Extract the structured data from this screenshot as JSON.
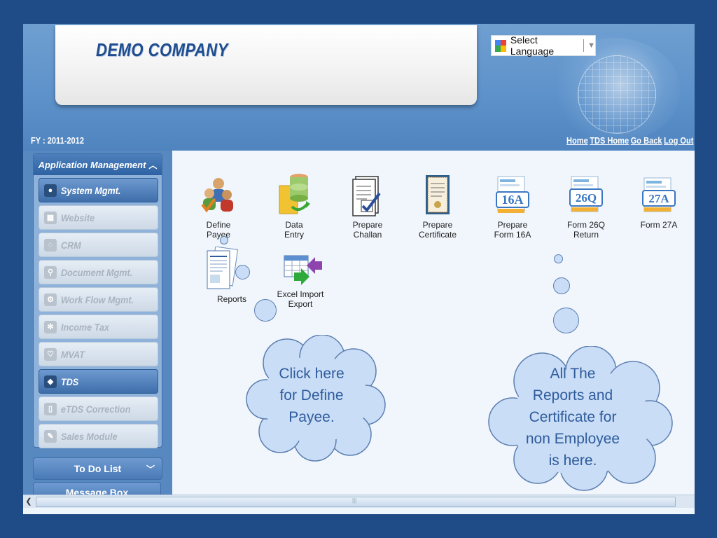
{
  "header": {
    "company": "DEMO COMPANY",
    "language_label": "Select Language",
    "fy": "FY : 2011-2012",
    "links": [
      "Home",
      "TDS Home",
      "Go Back",
      "Log Out"
    ]
  },
  "sidebar": {
    "heading": "Application Management",
    "items": [
      {
        "label": "System Mgmt.",
        "state": "active"
      },
      {
        "label": "Website",
        "state": "disabled"
      },
      {
        "label": "CRM",
        "state": "disabled"
      },
      {
        "label": "Document Mgmt.",
        "state": "disabled"
      },
      {
        "label": "Work Flow Mgmt.",
        "state": "disabled"
      },
      {
        "label": "Income Tax",
        "state": "disabled"
      },
      {
        "label": "MVAT",
        "state": "disabled"
      },
      {
        "label": "TDS",
        "state": "active"
      },
      {
        "label": "eTDS Correction",
        "state": "disabled"
      },
      {
        "label": "Sales Module",
        "state": "disabled"
      }
    ],
    "todo": "To Do List",
    "message_box": "Message Box"
  },
  "tiles": [
    {
      "label": "Define Payee",
      "lines": [
        "Define",
        "Payee"
      ],
      "icon": "users-icon"
    },
    {
      "label": "Data Entry",
      "lines": [
        "Data",
        "Entry"
      ],
      "icon": "database-icon"
    },
    {
      "label": "Prepare Challan",
      "lines": [
        "Prepare",
        "Challan"
      ],
      "icon": "checklist-icon"
    },
    {
      "label": "Prepare Certificate",
      "lines": [
        "Prepare",
        "Certificate"
      ],
      "icon": "certificate-icon"
    },
    {
      "label": "Prepare Form 16A",
      "lines": [
        "Prepare",
        "Form 16A"
      ],
      "icon": "form-16a-icon",
      "badge": "16A"
    },
    {
      "label": "Form 26Q Return",
      "lines": [
        "Form 26Q",
        "Return"
      ],
      "icon": "form-26q-icon",
      "badge": "26Q"
    },
    {
      "label": "Form 27A",
      "lines": [
        "Form 27A"
      ],
      "icon": "form-27a-icon",
      "badge": "27A"
    },
    {
      "label": "Reports",
      "lines": [
        "Reports"
      ],
      "icon": "reports-icon"
    },
    {
      "label": "Excel Import Export",
      "lines": [
        "Excel Import",
        "Export"
      ],
      "icon": "excel-import-icon"
    }
  ],
  "callouts": {
    "left": [
      "Click here",
      "for Define",
      "Payee."
    ],
    "right": [
      "All The",
      "Reports and",
      "Certificate for",
      "non Employee",
      "is here."
    ]
  },
  "colors": {
    "frame": "#1f4b86",
    "header_blue": "#5e92ca",
    "company_text": "#1f4d8f",
    "cloud_fill": "#c9ddf6",
    "cloud_text": "#2f5c9c"
  }
}
